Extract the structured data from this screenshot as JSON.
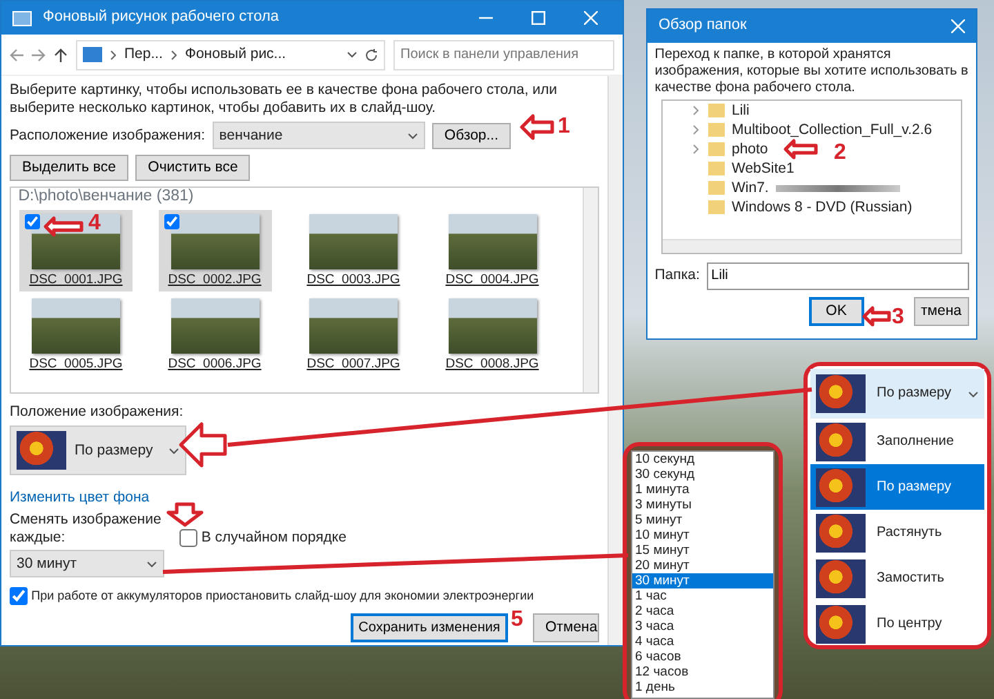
{
  "main_window": {
    "title": "Фоновый рисунок рабочего стола",
    "breadcrumbs": [
      "Пер...",
      "Фоновый рис..."
    ],
    "search": {
      "placeholder": "Поиск в панели управления"
    },
    "instructions": "Выберите картинку, чтобы использовать ее в качестве фона рабочего стола, или выберите несколько картинок, чтобы добавить их в слайд-шоу.",
    "location_label": "Расположение изображения:",
    "location_value": "венчание",
    "browse_button": "Обзор...",
    "select_all_button": "Выделить все",
    "clear_all_button": "Очистить все",
    "group_title": "D:\\photo\\венчание (381)",
    "photos": [
      {
        "name": "DSC_0001.JPG",
        "checked": true
      },
      {
        "name": "DSC_0002.JPG",
        "checked": true
      },
      {
        "name": "DSC_0003.JPG",
        "checked": false
      },
      {
        "name": "DSC_0004.JPG",
        "checked": false
      },
      {
        "name": "DSC_0005.JPG",
        "checked": false
      },
      {
        "name": "DSC_0006.JPG",
        "checked": false
      },
      {
        "name": "DSC_0007.JPG",
        "checked": false
      },
      {
        "name": "DSC_0008.JPG",
        "checked": false
      }
    ],
    "position_label": "Положение изображения:",
    "position_value": "По размеру",
    "change_color_link": "Изменить цвет фона",
    "interval_label": "Сменять изображение каждые:",
    "shuffle": {
      "label": "В случайном порядке",
      "checked": false
    },
    "interval_value": "30 минут",
    "battery": {
      "label": "При работе от аккумуляторов приостановить слайд-шоу для экономии электроэнергии",
      "checked": true
    },
    "save_button": "Сохранить изменения",
    "cancel_button": "Отмена"
  },
  "folder_dialog": {
    "title": "Обзор папок",
    "instructions": "Переход к папке, в которой хранятся изображения, которые вы хотите использовать в качестве фона рабочего стола.",
    "folders": [
      {
        "name": "Lili",
        "expandable": true
      },
      {
        "name": "Multiboot_Collection_Full_v.2.6",
        "expandable": true
      },
      {
        "name": "photo",
        "expandable": true
      },
      {
        "name": "WebSite1",
        "expandable": false
      },
      {
        "name": "Win7.",
        "expandable": false
      },
      {
        "name": "Windows 8 - DVD (Russian)",
        "expandable": false
      }
    ],
    "folder_label": "Папка:",
    "folder_value": "Lili",
    "ok_button": "OK",
    "cancel_button": "тмена"
  },
  "interval_list": [
    {
      "label": "10 секунд",
      "selected": false
    },
    {
      "label": "30 секунд",
      "selected": false
    },
    {
      "label": "1 минута",
      "selected": false
    },
    {
      "label": "3 минуты",
      "selected": false
    },
    {
      "label": "5 минут",
      "selected": false
    },
    {
      "label": "10 минут",
      "selected": false
    },
    {
      "label": "15 минут",
      "selected": false
    },
    {
      "label": "20 минут",
      "selected": false
    },
    {
      "label": "30 минут",
      "selected": true
    },
    {
      "label": "1 час",
      "selected": false
    },
    {
      "label": "2 часа",
      "selected": false
    },
    {
      "label": "3 часа",
      "selected": false
    },
    {
      "label": "4 часа",
      "selected": false
    },
    {
      "label": "6 часов",
      "selected": false
    },
    {
      "label": "12 часов",
      "selected": false
    },
    {
      "label": "1 день",
      "selected": false
    }
  ],
  "position_list": {
    "current": "По размеру",
    "options": [
      {
        "label": "Заполнение",
        "selected": false
      },
      {
        "label": "По размеру",
        "selected": true
      },
      {
        "label": "Растянуть",
        "selected": false
      },
      {
        "label": "Замостить",
        "selected": false
      },
      {
        "label": "По центру",
        "selected": false
      }
    ]
  },
  "annotations": [
    {
      "label": "1"
    },
    {
      "label": "2"
    },
    {
      "label": "3"
    },
    {
      "label": "4"
    },
    {
      "label": "5"
    }
  ]
}
